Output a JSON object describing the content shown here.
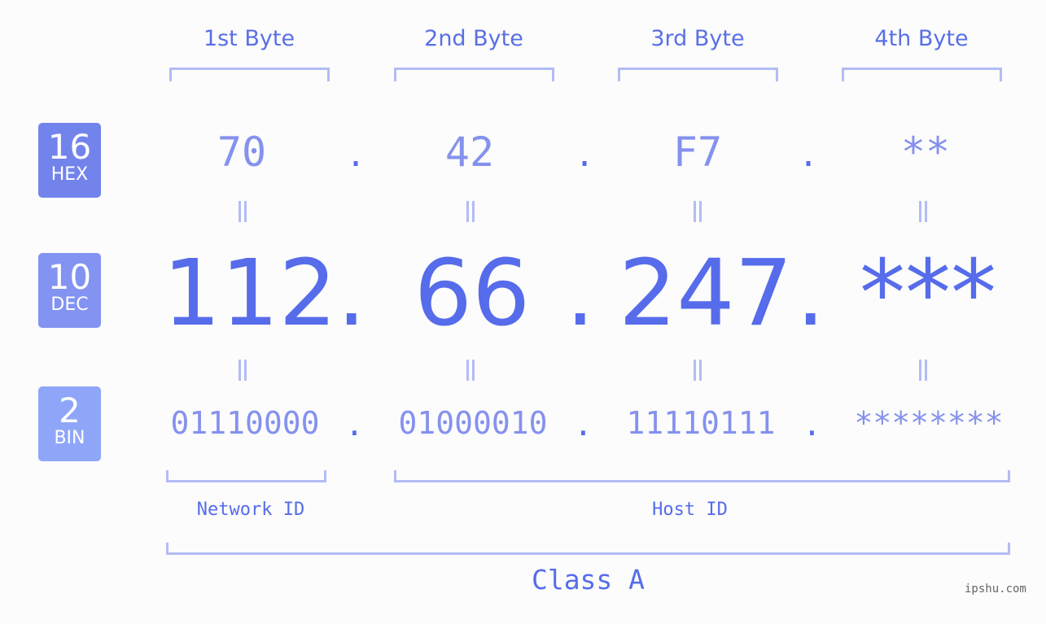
{
  "headers": [
    "1st Byte",
    "2nd Byte",
    "3rd Byte",
    "4th Byte"
  ],
  "bases": [
    {
      "num": "16",
      "label": "HEX",
      "color": "#7383ec"
    },
    {
      "num": "10",
      "label": "DEC",
      "color": "#8293f2"
    },
    {
      "num": "2",
      "label": "BIN",
      "color": "#8fa6f8"
    }
  ],
  "hex": [
    "70",
    "42",
    "F7",
    "**"
  ],
  "dec": [
    "112",
    "66",
    "247",
    "***"
  ],
  "bin": [
    "01110000",
    "01000010",
    "11110111",
    "********"
  ],
  "separator": ".",
  "network_label": "Network ID",
  "host_label": "Host ID",
  "class_label": "Class A",
  "watermark": "ipshu.com",
  "colors": {
    "accent": "#566ceb",
    "light": "#8591ee",
    "bracket": "#b3bcf5"
  }
}
